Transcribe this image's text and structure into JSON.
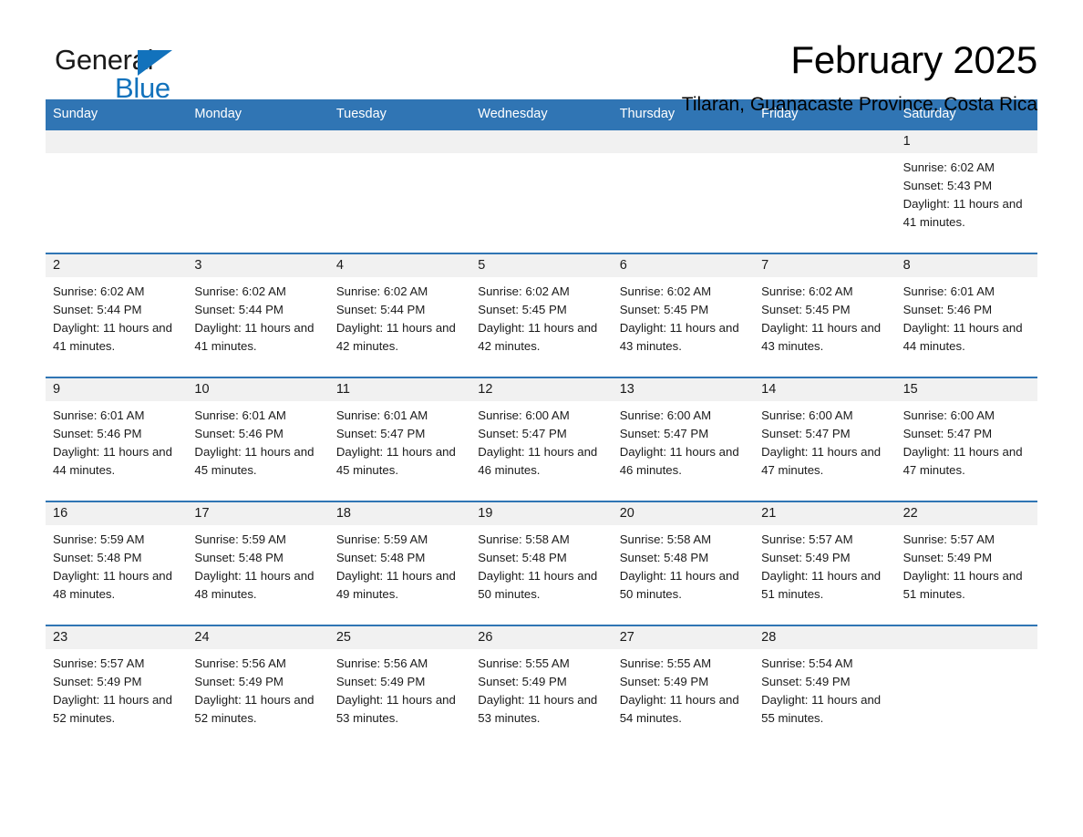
{
  "brand": {
    "name_dark": "General",
    "name_blue": "Blue",
    "accent_color": "#1272bc"
  },
  "header": {
    "title": "February 2025",
    "subtitle": "Tilaran, Guanacaste Province, Costa Rica"
  },
  "theme": {
    "header_blue": "#3075b4",
    "date_band_gray": "#f1f1f1"
  },
  "weekdays": [
    "Sunday",
    "Monday",
    "Tuesday",
    "Wednesday",
    "Thursday",
    "Friday",
    "Saturday"
  ],
  "weeks": [
    [
      {
        "day": "",
        "sunrise": "",
        "sunset": "",
        "daylight": "",
        "empty": true
      },
      {
        "day": "",
        "sunrise": "",
        "sunset": "",
        "daylight": "",
        "empty": true
      },
      {
        "day": "",
        "sunrise": "",
        "sunset": "",
        "daylight": "",
        "empty": true
      },
      {
        "day": "",
        "sunrise": "",
        "sunset": "",
        "daylight": "",
        "empty": true
      },
      {
        "day": "",
        "sunrise": "",
        "sunset": "",
        "daylight": "",
        "empty": true
      },
      {
        "day": "",
        "sunrise": "",
        "sunset": "",
        "daylight": "",
        "empty": true
      },
      {
        "day": "1",
        "sunrise": "Sunrise: 6:02 AM",
        "sunset": "Sunset: 5:43 PM",
        "daylight": "Daylight: 11 hours and 41 minutes.",
        "empty": false
      }
    ],
    [
      {
        "day": "2",
        "sunrise": "Sunrise: 6:02 AM",
        "sunset": "Sunset: 5:44 PM",
        "daylight": "Daylight: 11 hours and 41 minutes.",
        "empty": false
      },
      {
        "day": "3",
        "sunrise": "Sunrise: 6:02 AM",
        "sunset": "Sunset: 5:44 PM",
        "daylight": "Daylight: 11 hours and 41 minutes.",
        "empty": false
      },
      {
        "day": "4",
        "sunrise": "Sunrise: 6:02 AM",
        "sunset": "Sunset: 5:44 PM",
        "daylight": "Daylight: 11 hours and 42 minutes.",
        "empty": false
      },
      {
        "day": "5",
        "sunrise": "Sunrise: 6:02 AM",
        "sunset": "Sunset: 5:45 PM",
        "daylight": "Daylight: 11 hours and 42 minutes.",
        "empty": false
      },
      {
        "day": "6",
        "sunrise": "Sunrise: 6:02 AM",
        "sunset": "Sunset: 5:45 PM",
        "daylight": "Daylight: 11 hours and 43 minutes.",
        "empty": false
      },
      {
        "day": "7",
        "sunrise": "Sunrise: 6:02 AM",
        "sunset": "Sunset: 5:45 PM",
        "daylight": "Daylight: 11 hours and 43 minutes.",
        "empty": false
      },
      {
        "day": "8",
        "sunrise": "Sunrise: 6:01 AM",
        "sunset": "Sunset: 5:46 PM",
        "daylight": "Daylight: 11 hours and 44 minutes.",
        "empty": false
      }
    ],
    [
      {
        "day": "9",
        "sunrise": "Sunrise: 6:01 AM",
        "sunset": "Sunset: 5:46 PM",
        "daylight": "Daylight: 11 hours and 44 minutes.",
        "empty": false
      },
      {
        "day": "10",
        "sunrise": "Sunrise: 6:01 AM",
        "sunset": "Sunset: 5:46 PM",
        "daylight": "Daylight: 11 hours and 45 minutes.",
        "empty": false
      },
      {
        "day": "11",
        "sunrise": "Sunrise: 6:01 AM",
        "sunset": "Sunset: 5:47 PM",
        "daylight": "Daylight: 11 hours and 45 minutes.",
        "empty": false
      },
      {
        "day": "12",
        "sunrise": "Sunrise: 6:00 AM",
        "sunset": "Sunset: 5:47 PM",
        "daylight": "Daylight: 11 hours and 46 minutes.",
        "empty": false
      },
      {
        "day": "13",
        "sunrise": "Sunrise: 6:00 AM",
        "sunset": "Sunset: 5:47 PM",
        "daylight": "Daylight: 11 hours and 46 minutes.",
        "empty": false
      },
      {
        "day": "14",
        "sunrise": "Sunrise: 6:00 AM",
        "sunset": "Sunset: 5:47 PM",
        "daylight": "Daylight: 11 hours and 47 minutes.",
        "empty": false
      },
      {
        "day": "15",
        "sunrise": "Sunrise: 6:00 AM",
        "sunset": "Sunset: 5:47 PM",
        "daylight": "Daylight: 11 hours and 47 minutes.",
        "empty": false
      }
    ],
    [
      {
        "day": "16",
        "sunrise": "Sunrise: 5:59 AM",
        "sunset": "Sunset: 5:48 PM",
        "daylight": "Daylight: 11 hours and 48 minutes.",
        "empty": false
      },
      {
        "day": "17",
        "sunrise": "Sunrise: 5:59 AM",
        "sunset": "Sunset: 5:48 PM",
        "daylight": "Daylight: 11 hours and 48 minutes.",
        "empty": false
      },
      {
        "day": "18",
        "sunrise": "Sunrise: 5:59 AM",
        "sunset": "Sunset: 5:48 PM",
        "daylight": "Daylight: 11 hours and 49 minutes.",
        "empty": false
      },
      {
        "day": "19",
        "sunrise": "Sunrise: 5:58 AM",
        "sunset": "Sunset: 5:48 PM",
        "daylight": "Daylight: 11 hours and 50 minutes.",
        "empty": false
      },
      {
        "day": "20",
        "sunrise": "Sunrise: 5:58 AM",
        "sunset": "Sunset: 5:48 PM",
        "daylight": "Daylight: 11 hours and 50 minutes.",
        "empty": false
      },
      {
        "day": "21",
        "sunrise": "Sunrise: 5:57 AM",
        "sunset": "Sunset: 5:49 PM",
        "daylight": "Daylight: 11 hours and 51 minutes.",
        "empty": false
      },
      {
        "day": "22",
        "sunrise": "Sunrise: 5:57 AM",
        "sunset": "Sunset: 5:49 PM",
        "daylight": "Daylight: 11 hours and 51 minutes.",
        "empty": false
      }
    ],
    [
      {
        "day": "23",
        "sunrise": "Sunrise: 5:57 AM",
        "sunset": "Sunset: 5:49 PM",
        "daylight": "Daylight: 11 hours and 52 minutes.",
        "empty": false
      },
      {
        "day": "24",
        "sunrise": "Sunrise: 5:56 AM",
        "sunset": "Sunset: 5:49 PM",
        "daylight": "Daylight: 11 hours and 52 minutes.",
        "empty": false
      },
      {
        "day": "25",
        "sunrise": "Sunrise: 5:56 AM",
        "sunset": "Sunset: 5:49 PM",
        "daylight": "Daylight: 11 hours and 53 minutes.",
        "empty": false
      },
      {
        "day": "26",
        "sunrise": "Sunrise: 5:55 AM",
        "sunset": "Sunset: 5:49 PM",
        "daylight": "Daylight: 11 hours and 53 minutes.",
        "empty": false
      },
      {
        "day": "27",
        "sunrise": "Sunrise: 5:55 AM",
        "sunset": "Sunset: 5:49 PM",
        "daylight": "Daylight: 11 hours and 54 minutes.",
        "empty": false
      },
      {
        "day": "28",
        "sunrise": "Sunrise: 5:54 AM",
        "sunset": "Sunset: 5:49 PM",
        "daylight": "Daylight: 11 hours and 55 minutes.",
        "empty": false
      },
      {
        "day": "",
        "sunrise": "",
        "sunset": "",
        "daylight": "",
        "empty": true
      }
    ]
  ]
}
